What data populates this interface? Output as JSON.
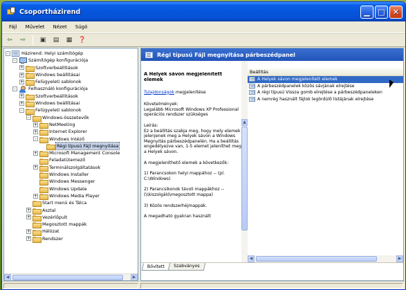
{
  "window": {
    "title": "Csoportházirend"
  },
  "menu": [
    "Fájl",
    "Művelet",
    "Nézet",
    "Súgó"
  ],
  "toolbar": {
    "buttons": [
      "back-icon",
      "forward-icon",
      "up-icon",
      "show-hide-tree-icon",
      "properties-icon",
      "help-icon"
    ]
  },
  "tree": [
    {
      "label": "Házirend: Helyi számítógép",
      "indent": 0,
      "exp": "-",
      "icon": "policy"
    },
    {
      "label": "Számítógép konfigurációja",
      "indent": 1,
      "exp": "-",
      "icon": "pc"
    },
    {
      "label": "Szoftverbeállítások",
      "indent": 2,
      "exp": "+",
      "icon": "folder"
    },
    {
      "label": "Windows beállításai",
      "indent": 2,
      "exp": "+",
      "icon": "folder"
    },
    {
      "label": "Felügyeleti sablonok",
      "indent": 2,
      "exp": "+",
      "icon": "folder"
    },
    {
      "label": "Felhasználó konfigurációja",
      "indent": 1,
      "exp": "-",
      "icon": "user"
    },
    {
      "label": "Szoftverbeállítások",
      "indent": 2,
      "exp": "+",
      "icon": "folder"
    },
    {
      "label": "Windows beállításai",
      "indent": 2,
      "exp": "+",
      "icon": "folder"
    },
    {
      "label": "Felügyeleti sablonok",
      "indent": 2,
      "exp": "-",
      "icon": "folder"
    },
    {
      "label": "Windows-összetevők",
      "indent": 3,
      "exp": "-",
      "icon": "folder"
    },
    {
      "label": "NetMeeting",
      "indent": 4,
      "exp": "+",
      "icon": "folder"
    },
    {
      "label": "Internet Explorer",
      "indent": 4,
      "exp": "+",
      "icon": "folder"
    },
    {
      "label": "Windows Intéző",
      "indent": 4,
      "exp": "-",
      "icon": "folder"
    },
    {
      "label": "Régi típusú Fájl megnyitása",
      "indent": 5,
      "exp": "",
      "icon": "folder",
      "selected": true
    },
    {
      "label": "Microsoft Management Console",
      "indent": 4,
      "exp": "+",
      "icon": "folder"
    },
    {
      "label": "Feladatütemező",
      "indent": 4,
      "exp": "",
      "icon": "folder"
    },
    {
      "label": "Terminálszolgáltatások",
      "indent": 4,
      "exp": "+",
      "icon": "folder"
    },
    {
      "label": "Windows Installer",
      "indent": 4,
      "exp": "",
      "icon": "folder"
    },
    {
      "label": "Windows Messenger",
      "indent": 4,
      "exp": "",
      "icon": "folder"
    },
    {
      "label": "Windows Update",
      "indent": 4,
      "exp": "",
      "icon": "folder"
    },
    {
      "label": "Windows Media Player",
      "indent": 4,
      "exp": "+",
      "icon": "folder"
    },
    {
      "label": "Start menü és Tálca",
      "indent": 3,
      "exp": "",
      "icon": "folder"
    },
    {
      "label": "Asztal",
      "indent": 3,
      "exp": "+",
      "icon": "folder"
    },
    {
      "label": "Vezérlőpult",
      "indent": 3,
      "exp": "+",
      "icon": "folder"
    },
    {
      "label": "Megosztott mappák",
      "indent": 3,
      "exp": "",
      "icon": "folder"
    },
    {
      "label": "Hálózat",
      "indent": 3,
      "exp": "+",
      "icon": "folder"
    },
    {
      "label": "Rendszer",
      "indent": 3,
      "exp": "+",
      "icon": "folder"
    }
  ],
  "detail": {
    "header": "Régi típusú Fájl megnyitása párbeszédpanel",
    "desc_title": "A Helyek sávon megjelenített elemek",
    "properties_link": "Tulajdonságok",
    "properties_suffix": " megjelenítése",
    "requirements": "Követelmények:\nLegalább Microsoft Windows XP Professional operációs rendszer szükséges",
    "description": "Leírás:\nEz a beállítás szabja meg, hogy mely elemek jelenjenek meg a Helyek sávon a Windows Megnyitás párbeszédpanelén. Ha a beállítás engedélyezve van, 1-5 elemet jeleníthet meg a Helyek sávon.",
    "items_intro": "A megjeleníthető elemek a következők:",
    "item1": "1) Parancsokon helyi mappához -- (pl. C:\\Windows)",
    "item2": "2) Parancsikonok távoli mappákhoz -- (\\\\kiszolgáló\\megosztott mappa)",
    "item3": "3) Közös rendszerhéjmappák.",
    "tail": "A megadható gyakran használt"
  },
  "list": {
    "column": "Beállítás",
    "rows": [
      "A Helyek sávon megjelenített elemek",
      "A párbeszédpanelek közös sávjának elrejtése",
      "A régi típusú Vissza gomb elrejtése a párbeszédpaneleken",
      "A nemrég használt fájlok legördülő listájának elrejtése"
    ],
    "selected_index": 0
  },
  "tabs": [
    "Bővített",
    "Szabványos"
  ],
  "active_tab": 0
}
